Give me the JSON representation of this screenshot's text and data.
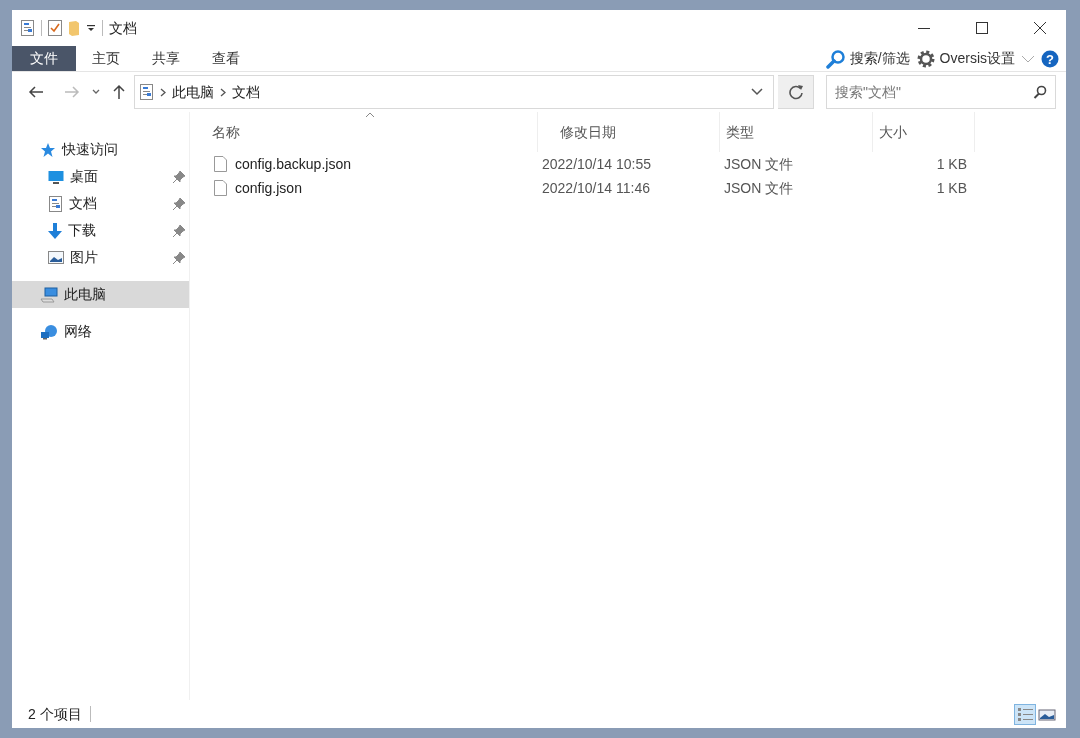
{
  "window": {
    "title": "文档"
  },
  "ribbon_tabs": [
    {
      "label": "文件",
      "selected": true
    },
    {
      "label": "主页",
      "selected": false
    },
    {
      "label": "共享",
      "selected": false
    },
    {
      "label": "查看",
      "selected": false
    }
  ],
  "ribbon_right": [
    {
      "kind": "search",
      "label": "搜索/筛选"
    },
    {
      "kind": "settings",
      "label": "Oversis设置"
    }
  ],
  "help_button": {
    "label": "?"
  },
  "address_bar": {
    "path": [
      "此电脑",
      "文档"
    ]
  },
  "search": {
    "placeholder": "搜索\"文档\""
  },
  "sidebar": {
    "items": [
      {
        "kind": "star",
        "label": "快速访问",
        "selected": false,
        "children": [
          {
            "kind": "desktop",
            "label": "桌面",
            "pinned": true,
            "selected": false
          },
          {
            "kind": "document",
            "label": "文档",
            "pinned": true,
            "selected": false
          },
          {
            "kind": "download",
            "label": "下载",
            "pinned": true,
            "selected": false
          },
          {
            "kind": "picture",
            "label": "图片",
            "pinned": true,
            "selected": false
          }
        ]
      },
      {
        "kind": "computer",
        "label": "此电脑",
        "selected": true
      },
      {
        "kind": "network",
        "label": "网络",
        "selected": false
      }
    ]
  },
  "table": {
    "columns": [
      {
        "label": "名称",
        "sorted": true
      },
      {
        "label": "修改日期",
        "sorted": false
      },
      {
        "label": "类型",
        "sorted": false
      },
      {
        "label": "大小",
        "sorted": false
      }
    ],
    "rows": [
      {
        "name": "config.backup.json",
        "modified": "2022/10/14 10:55",
        "type": "JSON 文件",
        "size": "1 KB"
      },
      {
        "name": "config.json",
        "modified": "2022/10/14 11:46",
        "type": "JSON 文件",
        "size": "1 KB"
      }
    ]
  },
  "status_bar": {
    "text": "2 个项目",
    "views": [
      {
        "kind": "details",
        "selected": true
      },
      {
        "kind": "large-icons",
        "selected": false
      }
    ]
  }
}
